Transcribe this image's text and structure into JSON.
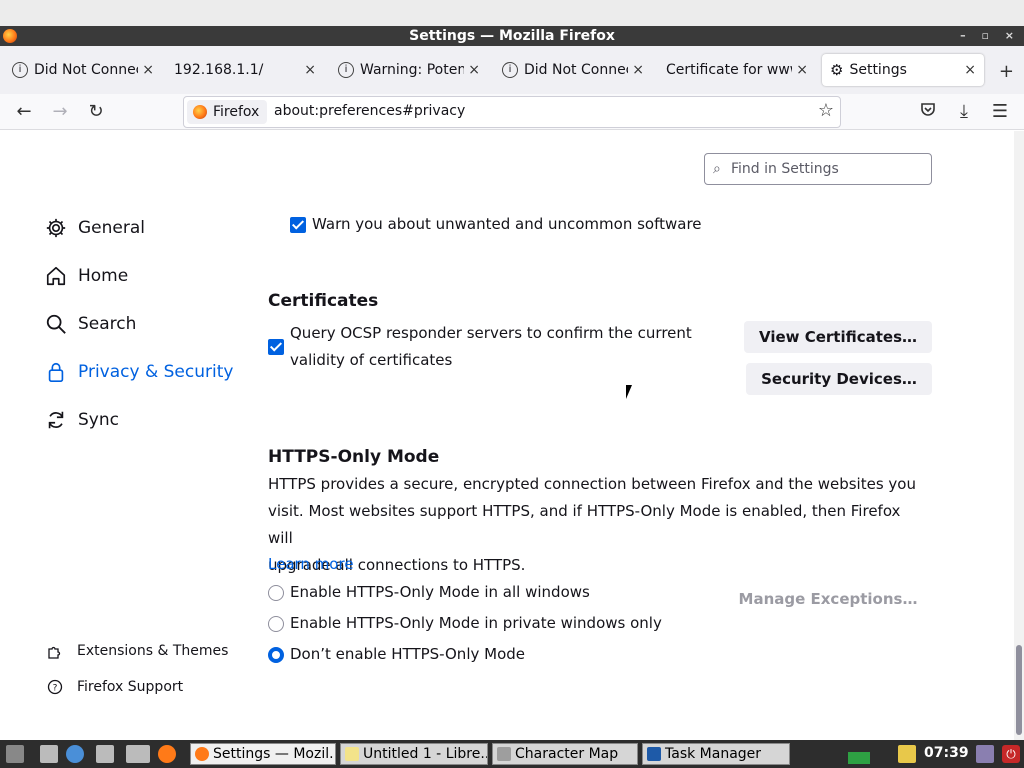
{
  "window": {
    "title": "Settings — Mozilla Firefox",
    "wm_buttons": "– ▫ ×"
  },
  "tabs": [
    {
      "label": "Did Not Connect",
      "icon": "info-icon"
    },
    {
      "label": "192.168.1.1/",
      "icon": ""
    },
    {
      "label": "Warning: Potential",
      "icon": "info-icon"
    },
    {
      "label": "Did Not Connect",
      "icon": "info-icon"
    },
    {
      "label": "Certificate for www",
      "icon": ""
    },
    {
      "label": "Settings",
      "icon": "gear-icon",
      "active": true
    }
  ],
  "navbar": {
    "identity_label": "Firefox",
    "url": "about:preferences#privacy"
  },
  "search": {
    "placeholder": "Find in Settings"
  },
  "sidebar": {
    "items": [
      {
        "label": "General",
        "icon": "gear-icon"
      },
      {
        "label": "Home",
        "icon": "home-icon"
      },
      {
        "label": "Search",
        "icon": "search-icon"
      },
      {
        "label": "Privacy & Security",
        "icon": "lock-icon",
        "selected": true
      },
      {
        "label": "Sync",
        "icon": "sync-icon"
      }
    ],
    "footer": [
      {
        "label": "Extensions & Themes",
        "icon": "puzzle-icon"
      },
      {
        "label": "Firefox Support",
        "icon": "help-icon"
      }
    ]
  },
  "main": {
    "warn_software": {
      "label": "Warn you about unwanted and uncommon software",
      "checked": true
    },
    "certificates": {
      "heading": "Certificates",
      "ocsp_line1": "Query OCSP responder servers to confirm the current",
      "ocsp_line2": "validity of certificates",
      "ocsp_checked": true,
      "view_button": "View Certificates…",
      "devices_button": "Security Devices…"
    },
    "https_only": {
      "heading": "HTTPS-Only Mode",
      "description_line1": "HTTPS provides a secure, encrypted connection between Firefox and the websites you",
      "description_line2": "visit. Most websites support HTTPS, and if HTTPS-Only Mode is enabled, then Firefox will",
      "description_line3": "upgrade all connections to HTTPS.",
      "learn_more": "Learn more",
      "manage_button": "Manage Exceptions…",
      "options": [
        {
          "label": "Enable HTTPS-Only Mode in all windows",
          "selected": false
        },
        {
          "label": "Enable HTTPS-Only Mode in private windows only",
          "selected": false
        },
        {
          "label": "Don’t enable HTTPS-Only Mode",
          "selected": true
        }
      ]
    }
  },
  "taskbar": {
    "tasks": [
      {
        "label": "Settings — Mozil...",
        "active": true
      },
      {
        "label": "Untitled 1 - Libre...",
        "active": false
      },
      {
        "label": "Character Map",
        "active": false
      },
      {
        "label": "Task Manager",
        "active": false
      }
    ],
    "clock": "07:39"
  },
  "colors": {
    "accent": "#0061e0",
    "titlebar": "#3a3a3a",
    "taskbar": "#2d2d2d"
  }
}
